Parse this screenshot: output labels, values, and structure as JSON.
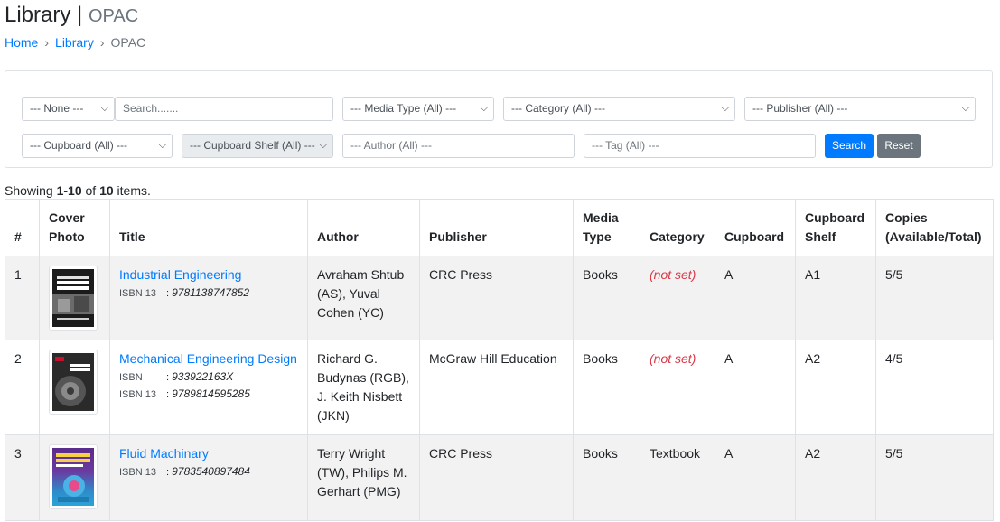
{
  "header": {
    "title": "Library",
    "separator": "|",
    "subtitle": "OPAC"
  },
  "breadcrumb": {
    "items": [
      "Home",
      "Library"
    ],
    "current": "OPAC",
    "divider": "›"
  },
  "filters": {
    "search_field_select": "--- None ---",
    "search_placeholder": "Search.......",
    "media_type": "--- Media Type (All) ---",
    "category": "--- Category (All) ---",
    "publisher": "--- Publisher (All) ---",
    "cupboard": "--- Cupboard (All) ---",
    "cupboard_shelf": "--- Cupboard Shelf (All) ---",
    "author_placeholder": "--- Author (All) ---",
    "tag_placeholder": "--- Tag (All) ---",
    "search_button": "Search",
    "reset_button": "Reset"
  },
  "summary": {
    "prefix": "Showing ",
    "range": "1-10",
    "of": " of ",
    "total": "10",
    "suffix": " items."
  },
  "table": {
    "headers": {
      "num": "#",
      "cover_l1": "Cover",
      "cover_l2": "Photo",
      "title": "Title",
      "author": "Author",
      "publisher": "Publisher",
      "media_l1": "Media",
      "media_l2": "Type",
      "category": "Category",
      "cupboard": "Cupboard",
      "shelf_l1": "Cupboard",
      "shelf_l2": "Shelf",
      "copies_l1": "Copies",
      "copies_l2": "(Available/Total)"
    },
    "rows": [
      {
        "num": "1",
        "title": "Industrial Engineering",
        "isbn": [
          {
            "label": "ISBN 13",
            "value": "9781138747852"
          }
        ],
        "author_lines": [
          "Avraham Shtub",
          "(AS), Yuval",
          "Cohen (YC)"
        ],
        "publisher": "CRC Press",
        "media": "Books",
        "category": "(not set)",
        "cupboard": "A",
        "shelf": "A1",
        "copies": "5/5"
      },
      {
        "num": "2",
        "title": "Mechanical Engineering Design",
        "isbn": [
          {
            "label": "ISBN",
            "value": "933922163X"
          },
          {
            "label": "ISBN 13",
            "value": "9789814595285"
          }
        ],
        "author_lines": [
          "Richard G.",
          "Budynas (RGB),",
          "J. Keith Nisbett",
          "(JKN)"
        ],
        "publisher": "McGraw Hill Education",
        "media": "Books",
        "category": "(not set)",
        "cupboard": "A",
        "shelf": "A2",
        "copies": "4/5"
      },
      {
        "num": "3",
        "title": "Fluid Machinary",
        "isbn": [
          {
            "label": "ISBN 13",
            "value": "9783540897484"
          }
        ],
        "author_lines": [
          "Terry Wright",
          "(TW), Philips M.",
          "Gerhart (PMG)"
        ],
        "publisher": "CRC Press",
        "media": "Books",
        "category": "Textbook",
        "cupboard": "A",
        "shelf": "A2",
        "copies": "5/5"
      }
    ]
  }
}
